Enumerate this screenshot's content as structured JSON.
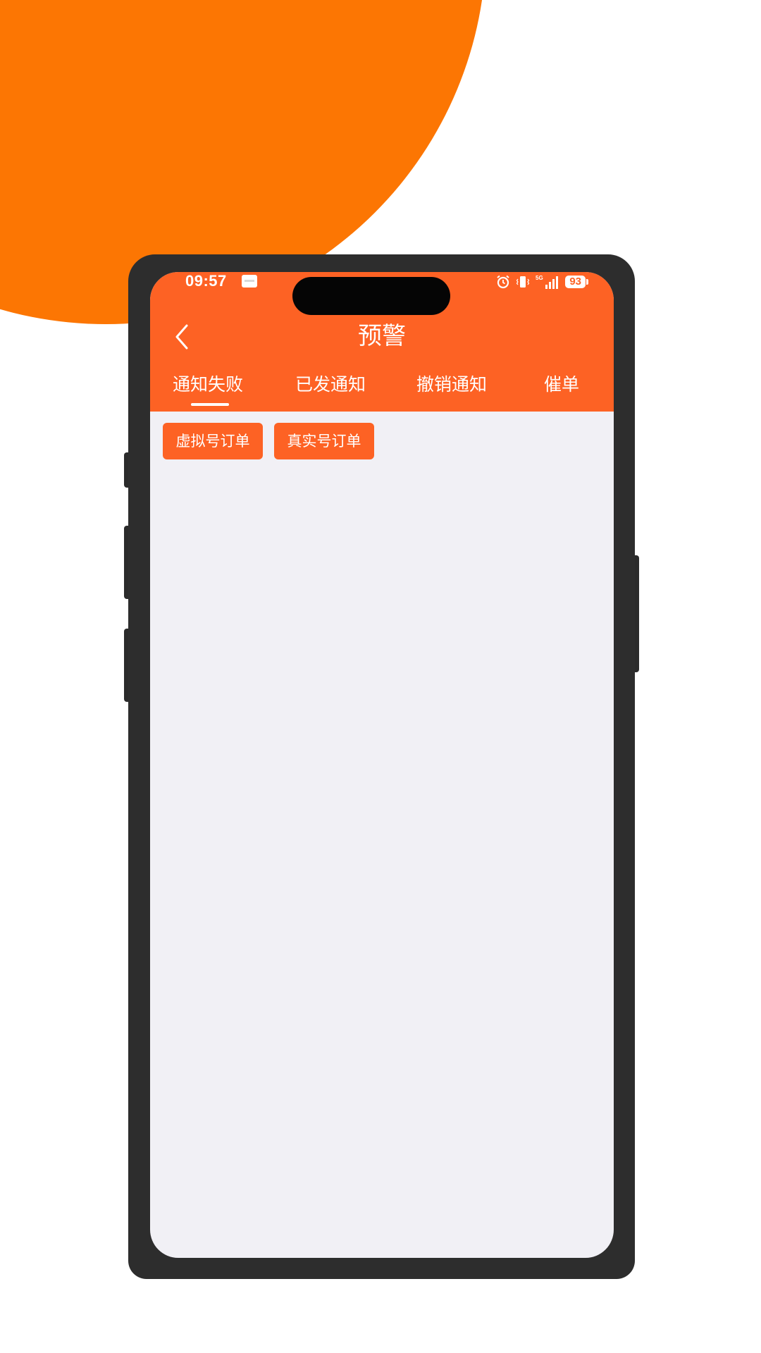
{
  "status_bar": {
    "time": "09:57",
    "battery": "93",
    "icons": [
      "app-notification-icon",
      "alarm-icon",
      "vibrate-icon",
      "signal-5g-icon",
      "battery-icon"
    ]
  },
  "header": {
    "title": "预警",
    "back_icon": "chevron-left-icon"
  },
  "tabs": [
    {
      "label": "通知失败",
      "active": true
    },
    {
      "label": "已发通知",
      "active": false
    },
    {
      "label": "撤销通知",
      "active": false
    },
    {
      "label": "催单",
      "active": false
    }
  ],
  "filters": [
    {
      "label": "虚拟号订单"
    },
    {
      "label": "真实号订单"
    }
  ],
  "colors": {
    "accent": "#FD6224",
    "backdrop_circle": "#FC7603",
    "content_bg": "#F1F0F5",
    "frame": "#2D2D2D"
  }
}
